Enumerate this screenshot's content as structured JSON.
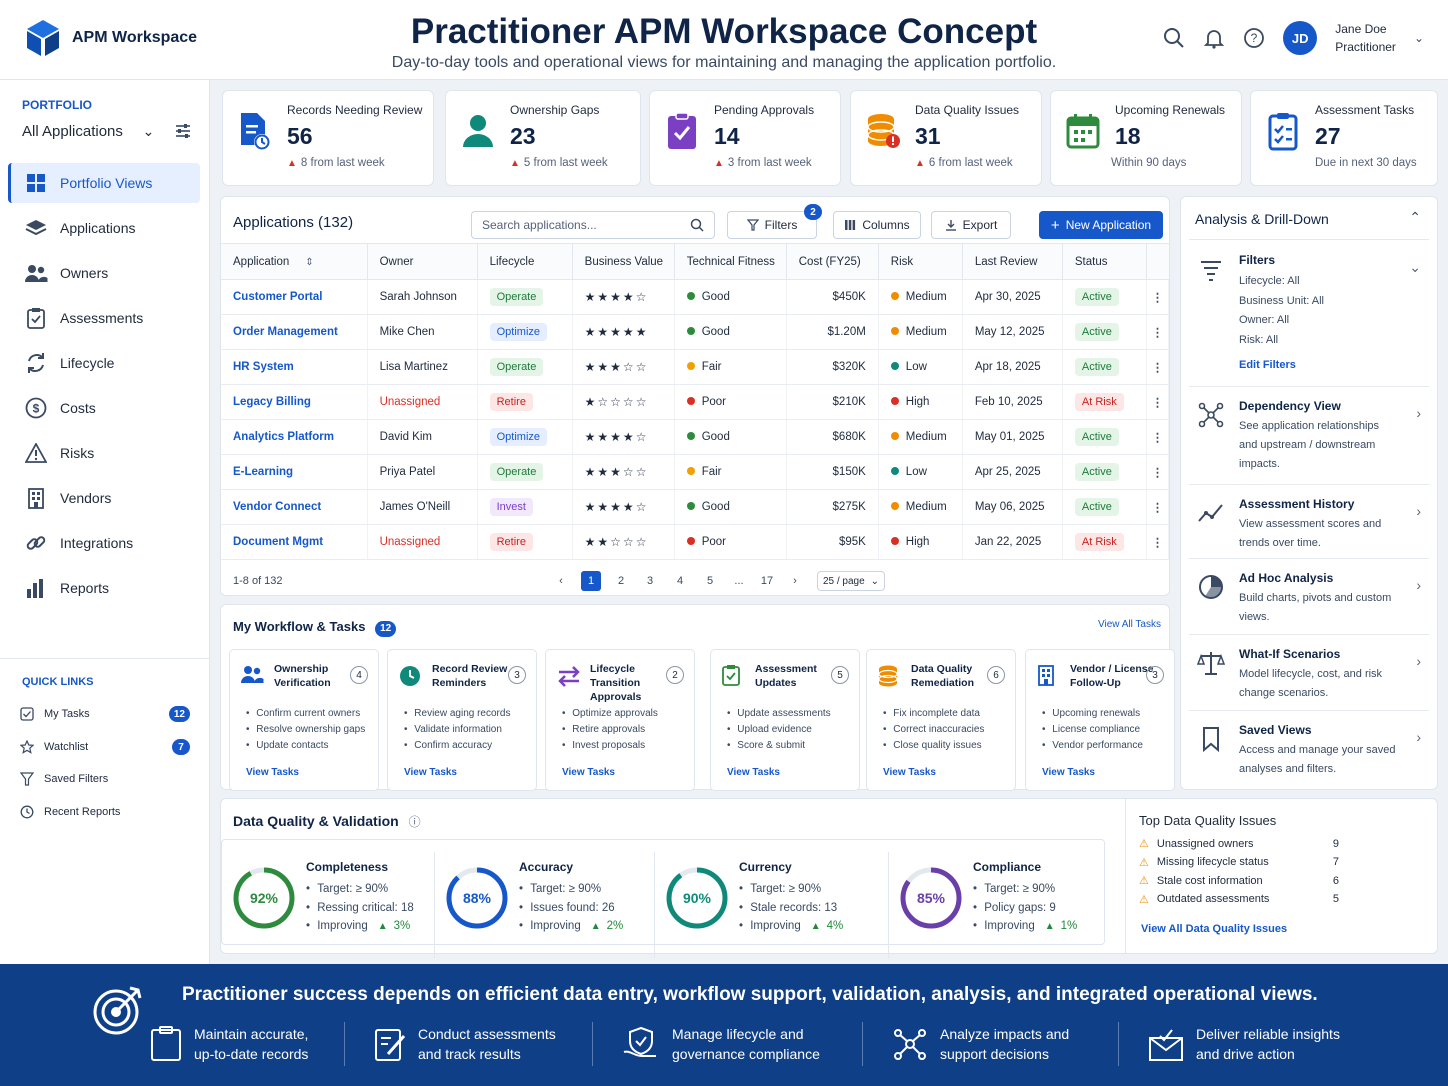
{
  "header": {
    "logo_text": "APM Workspace",
    "title": "Practitioner APM Workspace Concept",
    "subtitle": "Day-to-day tools and operational views for maintaining and managing the application portfolio.",
    "user_initials": "JD",
    "user_name": "Jane Doe",
    "user_role": "Practitioner"
  },
  "sidebar": {
    "portfolio_label": "PORTFOLIO",
    "portfolio_select": "All Applications",
    "nav": [
      {
        "label": "Portfolio Views",
        "icon": "grid-icon",
        "active": true
      },
      {
        "label": "Applications",
        "icon": "layers-icon"
      },
      {
        "label": "Owners",
        "icon": "users-icon"
      },
      {
        "label": "Assessments",
        "icon": "clipboard-icon"
      },
      {
        "label": "Lifecycle",
        "icon": "refresh-icon"
      },
      {
        "label": "Costs",
        "icon": "dollar-icon"
      },
      {
        "label": "Risks",
        "icon": "warning-icon"
      },
      {
        "label": "Vendors",
        "icon": "building-icon"
      },
      {
        "label": "Integrations",
        "icon": "link-icon"
      },
      {
        "label": "Reports",
        "icon": "bar-chart-icon"
      }
    ],
    "quick_links_label": "QUICK LINKS",
    "quick_links": [
      {
        "label": "My Tasks",
        "badge": "12",
        "icon": "checkbox-icon"
      },
      {
        "label": "Watchlist",
        "badge": "7",
        "icon": "star-icon"
      },
      {
        "label": "Saved Filters",
        "badge": "",
        "icon": "filter-icon"
      },
      {
        "label": "Recent Reports",
        "badge": "",
        "icon": "clock-icon"
      }
    ]
  },
  "kpis": [
    {
      "label": "Records Needing Review",
      "value": "56",
      "note": "8 from last week",
      "trend": "up",
      "color": "#1658c9"
    },
    {
      "label": "Ownership Gaps",
      "value": "23",
      "note": "5 from last week",
      "trend": "up",
      "color": "#0f8a7a"
    },
    {
      "label": "Pending Approvals",
      "value": "14",
      "note": "3 from last week",
      "trend": "up",
      "color": "#7b3fc4"
    },
    {
      "label": "Data Quality Issues",
      "value": "31",
      "note": "6 from last week",
      "trend": "up",
      "color": "#f08c00"
    },
    {
      "label": "Upcoming Renewals",
      "value": "18",
      "note": "Within 90 days",
      "trend": "none",
      "color": "#2e8b3e"
    },
    {
      "label": "Assessment Tasks",
      "value": "27",
      "note": "Due in next 30 days",
      "trend": "none",
      "color": "#1658c9"
    }
  ],
  "applications": {
    "title": "Applications (132)",
    "search_placeholder": "Search applications...",
    "filters_label": "Filters",
    "filters_badge": "2",
    "columns_label": "Columns",
    "export_label": "Export",
    "new_label": "New Application",
    "headers": [
      "Application",
      "Owner",
      "Lifecycle",
      "Business Value",
      "Technical Fitness",
      "Cost (FY25)",
      "Risk",
      "Last Review",
      "Status"
    ],
    "rows": [
      {
        "app": "Customer Portal",
        "owner": "Sarah Johnson",
        "lifecycle": "Operate",
        "stars": "★★★★☆",
        "fitness": "Good",
        "cost": "$450K",
        "risk": "Medium",
        "review": "Apr 30, 2025",
        "status": "Active"
      },
      {
        "app": "Order Management",
        "owner": "Mike Chen",
        "lifecycle": "Optimize",
        "stars": "★★★★★",
        "fitness": "Good",
        "cost": "$1.20M",
        "risk": "Medium",
        "review": "May 12, 2025",
        "status": "Active"
      },
      {
        "app": "HR System",
        "owner": "Lisa Martinez",
        "lifecycle": "Operate",
        "stars": "★★★☆☆",
        "fitness": "Fair",
        "cost": "$320K",
        "risk": "Low",
        "review": "Apr 18, 2025",
        "status": "Active"
      },
      {
        "app": "Legacy Billing",
        "owner": "Unassigned",
        "lifecycle": "Retire",
        "stars": "★☆☆☆☆",
        "fitness": "Poor",
        "cost": "$210K",
        "risk": "High",
        "review": "Feb 10, 2025",
        "status": "At Risk"
      },
      {
        "app": "Analytics Platform",
        "owner": "David Kim",
        "lifecycle": "Optimize",
        "stars": "★★★★☆",
        "fitness": "Good",
        "cost": "$680K",
        "risk": "Medium",
        "review": "May 01, 2025",
        "status": "Active"
      },
      {
        "app": "E-Learning",
        "owner": "Priya Patel",
        "lifecycle": "Operate",
        "stars": "★★★☆☆",
        "fitness": "Fair",
        "cost": "$150K",
        "risk": "Low",
        "review": "Apr 25, 2025",
        "status": "Active"
      },
      {
        "app": "Vendor Connect",
        "owner": "James O'Neill",
        "lifecycle": "Invest",
        "stars": "★★★★☆",
        "fitness": "Good",
        "cost": "$275K",
        "risk": "Medium",
        "review": "May 06, 2025",
        "status": "Active"
      },
      {
        "app": "Document Mgmt",
        "owner": "Unassigned",
        "lifecycle": "Retire",
        "stars": "★★☆☆☆",
        "fitness": "Poor",
        "cost": "$95K",
        "risk": "High",
        "review": "Jan 22, 2025",
        "status": "At Risk"
      }
    ],
    "range_text": "1-8 of 132",
    "pages": [
      "1",
      "2",
      "3",
      "4",
      "5",
      "...",
      "17"
    ],
    "page_size": "25 / page"
  },
  "workflow": {
    "title": "My Workflow & Tasks",
    "badge": "12",
    "view_all": "View All Tasks",
    "cards": [
      {
        "title": "Ownership Verification",
        "count": "4",
        "icon": "users-icon",
        "color": "#1658c9",
        "items": [
          "Confirm current owners",
          "Resolve ownership gaps",
          "Update contacts"
        ],
        "link": "View Tasks"
      },
      {
        "title": "Record Review Reminders",
        "count": "3",
        "icon": "clock-icon",
        "color": "#0f8a7a",
        "items": [
          "Review aging records",
          "Validate information",
          "Confirm accuracy"
        ],
        "link": "View Tasks"
      },
      {
        "title": "Lifecycle Transition Approvals",
        "count": "2",
        "icon": "swap-icon",
        "color": "#7b3fc4",
        "items": [
          "Optimize approvals",
          "Retire approvals",
          "Invest proposals"
        ],
        "link": "View Tasks"
      },
      {
        "title": "Assessment Updates",
        "count": "5",
        "icon": "clipboard-check-icon",
        "color": "#2e8b3e",
        "items": [
          "Update assessments",
          "Upload evidence",
          "Score & submit"
        ],
        "link": "View Tasks"
      },
      {
        "title": "Data Quality Remediation",
        "count": "6",
        "icon": "database-icon",
        "color": "#f08c00",
        "items": [
          "Fix incomplete data",
          "Correct inaccuracies",
          "Close quality issues"
        ],
        "link": "View Tasks"
      },
      {
        "title": "Vendor / License Follow-Up",
        "count": "3",
        "icon": "building-icon",
        "color": "#1658c9",
        "items": [
          "Upcoming renewals",
          "License compliance",
          "Vendor performance"
        ],
        "link": "View Tasks"
      }
    ]
  },
  "data_quality": {
    "title": "Data Quality & Validation",
    "metrics": [
      {
        "name": "Completeness",
        "value": 92,
        "label": "92%",
        "color": "#2e8b3e",
        "target": "Target: ≥ 90%",
        "detail": "Ressing critical: 18",
        "improving": "Improving",
        "delta": "3%"
      },
      {
        "name": "Accuracy",
        "value": 88,
        "label": "88%",
        "color": "#1658c9",
        "target": "Target: ≥ 90%",
        "detail": "Issues found: 26",
        "improving": "Improving",
        "delta": "2%"
      },
      {
        "name": "Currency",
        "value": 90,
        "label": "90%",
        "color": "#0f8a7a",
        "target": "Target: ≥ 90%",
        "detail": "Stale records: 13",
        "improving": "Improving",
        "delta": "4%"
      },
      {
        "name": "Compliance",
        "value": 85,
        "label": "85%",
        "color": "#6b3fa8",
        "target": "Target: ≥ 90%",
        "detail": "Policy gaps: 9",
        "improving": "Improving",
        "delta": "1%"
      }
    ],
    "top_issues_title": "Top Data Quality Issues",
    "top_issues": [
      {
        "label": "Unassigned owners",
        "count": "9"
      },
      {
        "label": "Missing lifecycle status",
        "count": "7"
      },
      {
        "label": "Stale cost information",
        "count": "6"
      },
      {
        "label": "Outdated assessments",
        "count": "5"
      }
    ],
    "view_all": "View All Data Quality Issues"
  },
  "analysis": {
    "title": "Analysis & Drill-Down",
    "filters_title": "Filters",
    "filters": [
      "Lifecycle: All",
      "Business Unit: All",
      "Owner: All",
      "Risk: All"
    ],
    "edit_filters": "Edit Filters",
    "items": [
      {
        "title": "Dependency View",
        "desc": "See application relationships and upstream / downstream impacts.",
        "icon": "network-icon"
      },
      {
        "title": "Assessment History",
        "desc": "View assessment scores and trends over time.",
        "icon": "trend-icon"
      },
      {
        "title": "Ad Hoc Analysis",
        "desc": "Build charts, pivots and custom views.",
        "icon": "pie-chart-icon"
      },
      {
        "title": "What-If Scenarios",
        "desc": "Model lifecycle, cost, and risk change scenarios.",
        "icon": "scale-icon"
      },
      {
        "title": "Saved Views",
        "desc": "Access and manage your saved analyses and filters.",
        "icon": "bookmark-icon"
      }
    ]
  },
  "footer": {
    "headline": "Practitioner success depends on efficient data entry, workflow support, validation, analysis, and integrated operational views.",
    "items": [
      {
        "line1": "Maintain accurate,",
        "line2": "up-to-date records",
        "icon": "clipboard-icon"
      },
      {
        "line1": "Conduct assessments",
        "line2": "and track results",
        "icon": "edit-icon"
      },
      {
        "line1": "Manage lifecycle and",
        "line2": "governance compliance",
        "icon": "shield-hand-icon"
      },
      {
        "line1": "Analyze impacts and",
        "line2": "support decisions",
        "icon": "network-icon"
      },
      {
        "line1": "Deliver reliable insights",
        "line2": "and drive action",
        "icon": "mail-icon"
      }
    ]
  }
}
